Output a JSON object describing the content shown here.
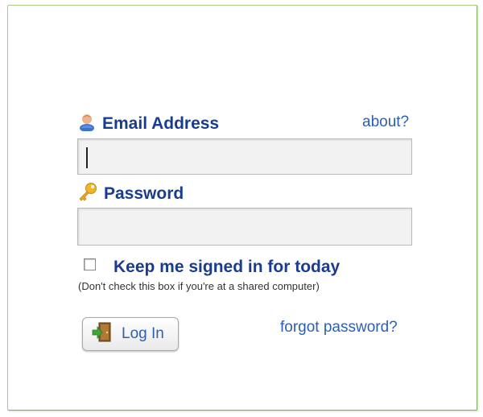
{
  "form": {
    "email_label": "Email Address",
    "about_link": "about?",
    "email_value": "",
    "password_label": "Password",
    "password_value": "",
    "keep_signed_label": "Keep me signed in for today",
    "keep_signed_checked": false,
    "keep_signed_hint": "(Don't check this box if you're at a shared computer)",
    "login_label": "Log In",
    "forgot_link": "forgot password?"
  },
  "icons": {
    "email": "user-icon",
    "password": "key-icon",
    "login": "door-exit-icon"
  },
  "colors": {
    "label_text": "#1a3c8f",
    "link_text": "#2c5fb3",
    "frame_border": "#a9cd82"
  }
}
